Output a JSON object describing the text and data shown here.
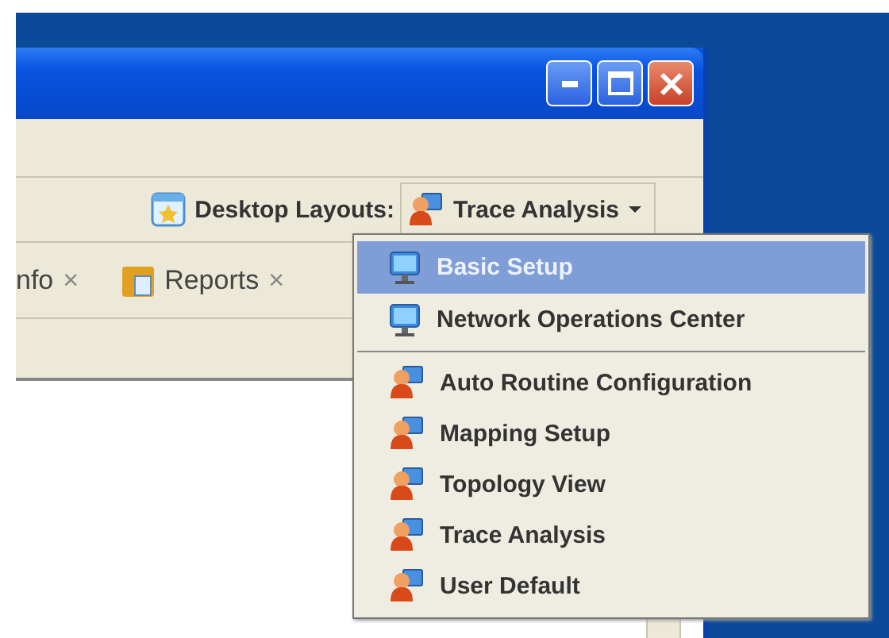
{
  "toolbar": {
    "label": "Desktop Layouts:",
    "layout_dropdown": {
      "value": "Trace Analysis",
      "expanded": true
    }
  },
  "tabs": [
    {
      "label": "nfo",
      "close": "×"
    },
    {
      "label": "Reports",
      "close": "×"
    }
  ],
  "layout_menu": {
    "groups": [
      {
        "items": [
          {
            "kind": "monitor",
            "label": "Basic Setup",
            "selected": true
          },
          {
            "kind": "monitor",
            "label": "Network Operations Center",
            "selected": false
          }
        ]
      },
      {
        "items": [
          {
            "kind": "user",
            "label": "Auto Routine Configuration",
            "selected": false
          },
          {
            "kind": "user",
            "label": "Mapping Setup",
            "selected": false
          },
          {
            "kind": "user",
            "label": "Topology View",
            "selected": false
          },
          {
            "kind": "user",
            "label": "Trace Analysis",
            "selected": false
          },
          {
            "kind": "user",
            "label": "User Default",
            "selected": false
          }
        ]
      }
    ]
  }
}
